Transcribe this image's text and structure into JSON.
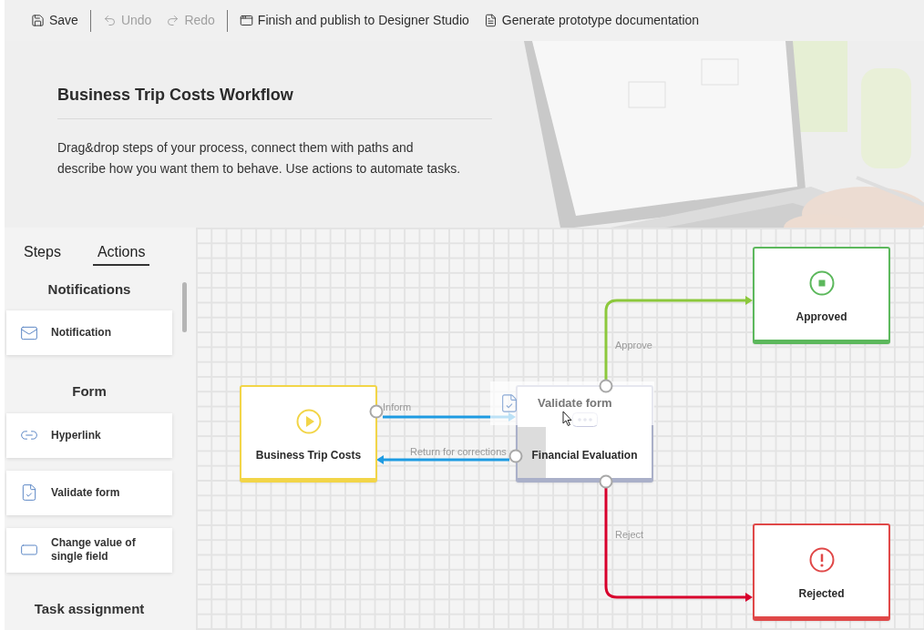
{
  "toolbar": {
    "groups": [
      [
        {
          "kind": "save",
          "label": "Save",
          "disabled": false
        }
      ],
      [
        {
          "kind": "undo",
          "label": "Undo",
          "disabled": true
        },
        {
          "kind": "redo",
          "label": "Redo",
          "disabled": true
        }
      ],
      [
        {
          "kind": "publish",
          "label": "Finish and publish to Designer Studio",
          "disabled": false
        },
        {
          "kind": "document",
          "label": "Generate prototype documentation",
          "disabled": false
        }
      ]
    ]
  },
  "header": {
    "title": "Business Trip Costs Workflow",
    "description": "Drag&drop steps of your process, connect them with paths and describe how you want them to behave. Use actions to automate tasks."
  },
  "sidebar": {
    "tabs": [
      {
        "label": "Steps",
        "selected": false
      },
      {
        "label": "Actions",
        "selected": true
      }
    ],
    "sections": [
      {
        "title": "Notifications",
        "items": [
          {
            "kind": "mail",
            "label": "Notification"
          }
        ]
      },
      {
        "title": "Form",
        "items": [
          {
            "kind": "link",
            "label": "Hyperlink"
          },
          {
            "kind": "validate",
            "label": "Validate form"
          },
          {
            "kind": "field",
            "label": "Change value of single field"
          }
        ]
      },
      {
        "title": "Task assignment"
      }
    ]
  },
  "canvas": {
    "nodes": [
      {
        "kind": "start",
        "label": "Business Trip Costs",
        "color": "#f2d548"
      },
      {
        "kind": "task",
        "label": "Financial Evaluation",
        "color": "#aab0c9"
      },
      {
        "kind": "approved",
        "label": "Approved",
        "color": "#5cb85c"
      },
      {
        "kind": "rejected",
        "label": "Rejected",
        "color": "#e04848"
      }
    ],
    "paths": [
      {
        "label": "Inform",
        "color": "#1e9be2"
      },
      {
        "label": "Return for corrections",
        "color": "#1e9be2"
      },
      {
        "label": "Approve",
        "color": "#8cc83c"
      },
      {
        "label": "Reject",
        "color": "#d8002c"
      }
    ],
    "drag_preview": {
      "label": "Validate form"
    }
  }
}
